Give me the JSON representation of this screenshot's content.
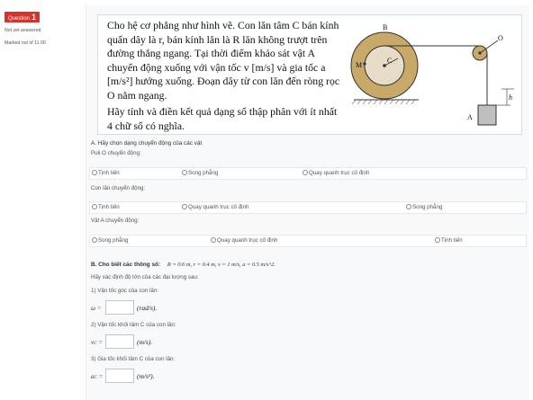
{
  "sidebar": {
    "question_word": "Question",
    "question_number": "1",
    "status": "Not yet answered",
    "marks": "Marked out of 11.00"
  },
  "question": {
    "para1": "Cho hệ cơ phẳng như hình vẽ. Con lăn tâm C bán kính quấn dây là r, bán kính lăn là R lăn không trượt trên đường thẳng ngang. Tại thời điểm khảo sát vật A chuyển động xuống với vận tốc v [m/s] và gia tốc a [m/s²] hướng xuống. Đoạn dây từ con lăn đến ròng rọc O nằm ngang.",
    "para2": "Hãy tính và điền kết quả dạng số thập phân với ít nhất 4 chữ số có nghĩa."
  },
  "figure": {
    "labels": {
      "B": "B",
      "M": "M",
      "C": "C",
      "O": "O",
      "A": "A",
      "h": "h"
    }
  },
  "part_a": {
    "title": "A. Hãy chọn dạng chuyển động của các vật",
    "groups": [
      {
        "label": "Puli O chuyển động:",
        "options": [
          "Tịnh tiến",
          "Song phẳng",
          "Quay quanh trục cố định"
        ]
      },
      {
        "label": "Con lăn chuyển động:",
        "options": [
          "Tịnh tiến",
          "Quay quanh trục cố định",
          "Song phẳng"
        ]
      },
      {
        "label": "Vật A chuyển động:",
        "options": [
          "Song phẳng",
          "Quay quanh trục cố định",
          "Tịnh tiến"
        ]
      }
    ]
  },
  "part_b": {
    "title": "B. Cho biết các thông số:",
    "params": "R = 0.6 m,  r = 0.4 m,  v = 1 m/s,  a = 0.5 m/s^2.",
    "intro": "Hãy xác định độ lớn của các đại lượng sau:",
    "items": [
      {
        "label": "1) Vận tốc góc của con lăn:",
        "symbol": "ω =",
        "value": "",
        "unit": "(rad/s)."
      },
      {
        "label": "2) Vận tốc khối tâm C của con lăn:",
        "symbol": "v",
        "symbol_sub": "C",
        "symbol_eq": " =",
        "value": "",
        "unit": "(m/s)."
      },
      {
        "label": "3) Gia tốc khối tâm C của con lăn:",
        "symbol": "a",
        "symbol_sub": "C",
        "symbol_eq": " =",
        "value": "",
        "unit": "(m/s²)."
      }
    ]
  }
}
